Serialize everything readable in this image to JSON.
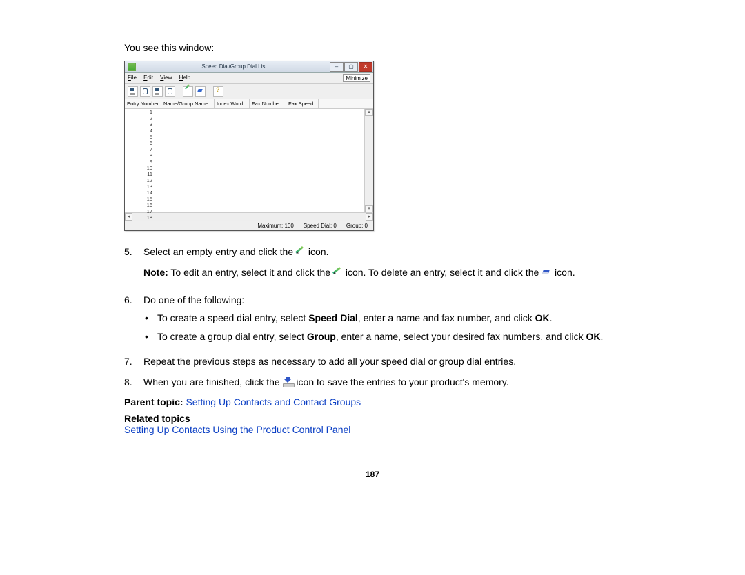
{
  "intro": "You see this window:",
  "window": {
    "title": "Speed Dial/Group Dial List",
    "menus": [
      "File",
      "Edit",
      "View",
      "Help"
    ],
    "minimize_label": "Minimize",
    "columns": [
      "Entry Number",
      "Name/Group Name",
      "Index Word",
      "Fax Number",
      "Fax Speed"
    ],
    "row_count": 18,
    "status": {
      "maximum": "Maximum: 100",
      "speed": "Speed Dial: 0",
      "group": "Group: 0"
    }
  },
  "steps": {
    "s5_num": "5.",
    "s5_a": "Select an empty entry and click the ",
    "s5_b": " icon.",
    "note_label": "Note:",
    "note_a": " To edit an entry, select it and click the ",
    "note_b": " icon. To delete an entry, select it and click the ",
    "note_c": " icon.",
    "s6_num": "6.",
    "s6": "Do one of the following:",
    "s6_sub1_a": "To create a speed dial entry, select ",
    "s6_sub1_b": "Speed Dial",
    "s6_sub1_c": ", enter a name and fax number, and click ",
    "s6_sub1_d": "OK",
    "s6_sub1_e": ".",
    "s6_sub2_a": "To create a group dial entry, select ",
    "s6_sub2_b": "Group",
    "s6_sub2_c": ", enter a name, select your desired fax numbers, and click ",
    "s6_sub2_d": "OK",
    "s6_sub2_e": ".",
    "s7_num": "7.",
    "s7": "Repeat the previous steps as necessary to add all your speed dial or group dial entries.",
    "s8_num": "8.",
    "s8_a": "When you are finished, click the ",
    "s8_b": " icon to save the entries to your product's memory."
  },
  "parent": {
    "label": "Parent topic: ",
    "link": "Setting Up Contacts and Contact Groups"
  },
  "related": {
    "label": "Related topics",
    "link": "Setting Up Contacts Using the Product Control Panel"
  },
  "page_number": "187"
}
